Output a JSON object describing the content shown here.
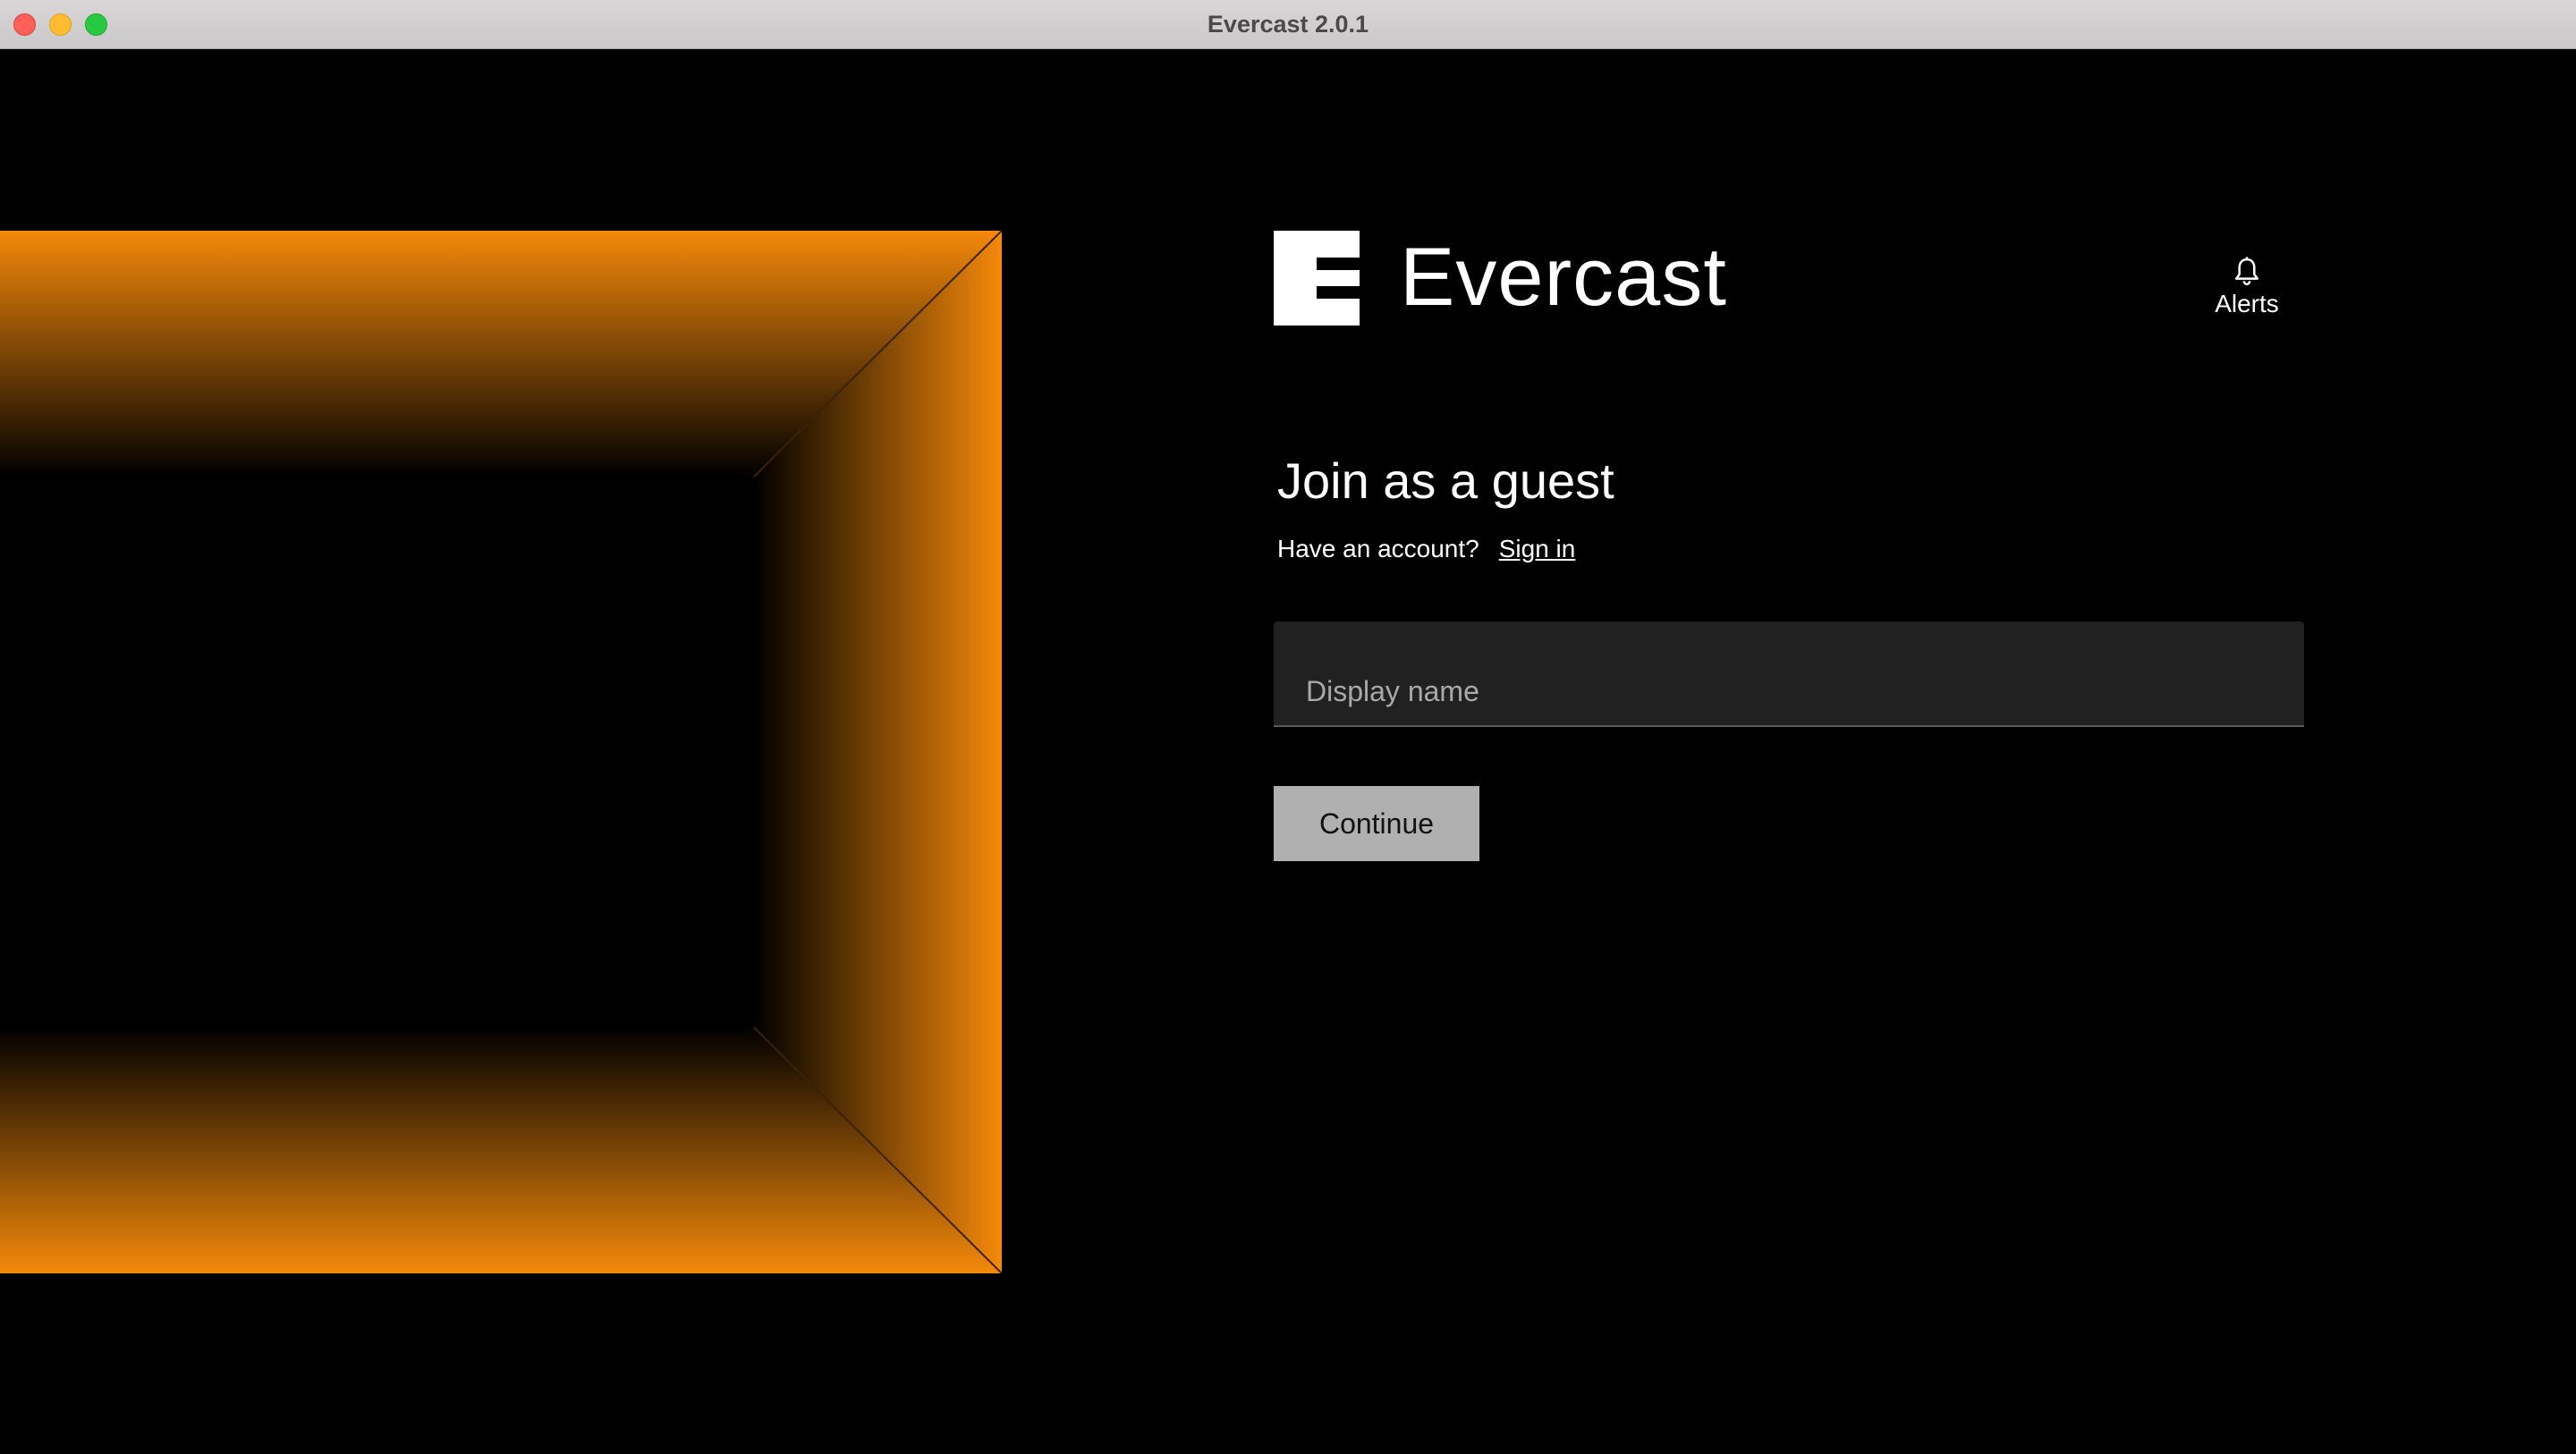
{
  "window": {
    "title": "Evercast 2.0.1"
  },
  "brand": {
    "name": "Evercast",
    "logo_icon": "evercast-e-logo"
  },
  "alerts": {
    "icon": "bell-icon",
    "label": "Alerts"
  },
  "form": {
    "heading": "Join as a guest",
    "account_prompt": "Have an account?",
    "signin_label": "Sign in",
    "display_name": {
      "value": "",
      "placeholder": "Display name"
    },
    "continue_label": "Continue"
  },
  "colors": {
    "accent_orange": "#f5890b",
    "background": "#000000",
    "input_bg": "#212121",
    "button_bg": "#b0b0b0"
  }
}
